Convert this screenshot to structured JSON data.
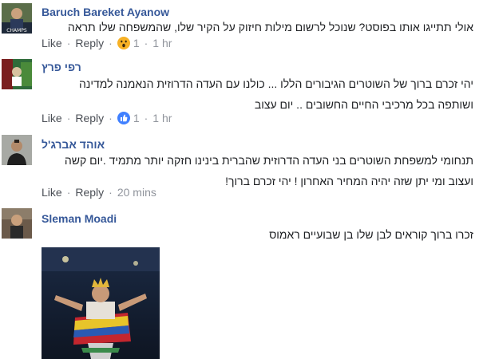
{
  "comments": [
    {
      "author": "Baruch Bareket Ayanow",
      "text": "אולי תתייגו אותו בפוסט? שנוכל לרשום מילות חיזוק על הקיר שלו, שהמשפחה שלו תראה",
      "like": "Like",
      "reply": "Reply",
      "reaction_icon": "wow-emoji-icon",
      "count": "1",
      "time": "1 hr",
      "avatar_caption": "CHAMPS"
    },
    {
      "author": "רפי פרץ",
      "lines": [
        "יהי זכרם ברוך של השוטרים הגיבורים הללו ... כולנו עם העדה הדרוזית הנאמנה למדינה",
        "ושותפה בכל מרכיבי החיים החשובים .. יום עצוב"
      ],
      "like": "Like",
      "reply": "Reply",
      "reaction_icon": "thumbs-up-icon",
      "count": "1",
      "time": "1 hr"
    },
    {
      "author": "אוהד אברג'ל",
      "lines": [
        "תנחומי למשפחת השוטרים בני העדה הדרוזית שהברית בינינו חזקה יותר מתמיד .יום קשה",
        "ועצוב ומי יתן שזה יהיה המחיר האחרון ! יהי זכרם ברוך!"
      ],
      "like": "Like",
      "reply": "Reply",
      "time": "20 mins"
    },
    {
      "author": "Sleman Moadi",
      "text": "זכרו ברוך קוראים לבן שלו בן שבועיים ראמוס"
    }
  ],
  "colors": {
    "name": "#365899",
    "meta": "#90949c",
    "text": "#1c1e21",
    "like_blue": "#4080ff",
    "wow_yellow": "#f7b125"
  }
}
